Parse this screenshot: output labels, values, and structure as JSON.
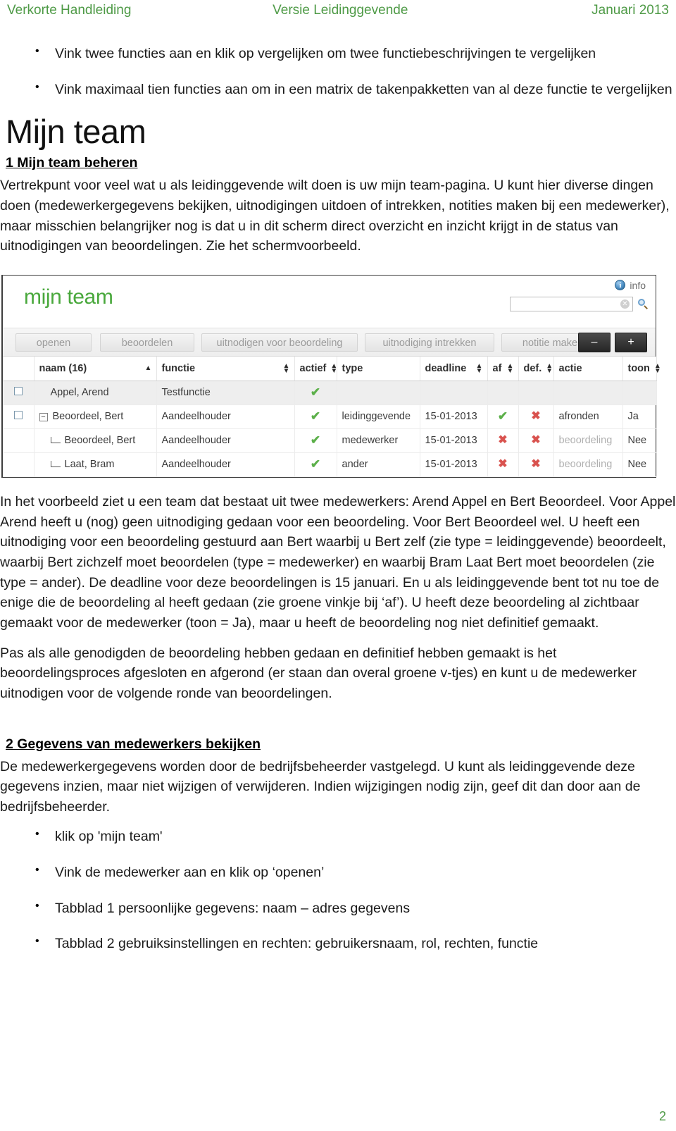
{
  "header": {
    "left": "Verkorte Handleiding",
    "center": "Versie Leidinggevende",
    "right": "Januari 2013"
  },
  "intro_bullets": [
    "Vink twee functies aan en klik op vergelijken om twee functiebeschrijvingen te vergelijken",
    "Vink maximaal tien functies aan om in een matrix de takenpakketten van al deze functie te vergelijken"
  ],
  "title": "Mijn team",
  "section1": {
    "heading": "1 Mijn team beheren",
    "paragraph": "Vertrekpunt voor veel wat u als leidinggevende wilt doen is uw mijn team-pagina. U kunt hier diverse dingen doen (medewerkergegevens bekijken, uitnodigingen uitdoen of intrekken, notities maken bij een medewerker), maar misschien belangrijker nog is dat u in dit scherm direct overzicht en inzicht krijgt in de status van uitnodigingen van beoordelingen. Zie het schermvoorbeeld."
  },
  "app_screenshot": {
    "logo": "mijn team",
    "info_icon": "info-icon",
    "info_label": "info",
    "search": {
      "value": "",
      "placeholder": "",
      "clear_icon": "clear-icon",
      "magnifier_icon": "search-icon"
    },
    "toolbar_buttons": [
      "openen",
      "beoordelen",
      "uitnodigen voor beoordeling",
      "uitnodiging intrekken",
      "notitie maken"
    ],
    "zoom_out_label": "–",
    "zoom_in_label": "+",
    "columns": [
      {
        "label": "naam (16)",
        "sort": "asc"
      },
      {
        "label": "functie",
        "sort": "both"
      },
      {
        "label": "actief",
        "sort": "both"
      },
      {
        "label": "type",
        "sort": "none"
      },
      {
        "label": "deadline",
        "sort": "both"
      },
      {
        "label": "af",
        "sort": "both"
      },
      {
        "label": "def.",
        "sort": "both"
      },
      {
        "label": "actie",
        "sort": "none"
      },
      {
        "label": "toon",
        "sort": "both"
      }
    ],
    "rows": [
      {
        "checkbox": true,
        "tree": "none",
        "indent": 0,
        "naam": "Appel, Arend",
        "functie": "Testfunctie",
        "actief": "check",
        "type": "",
        "deadline": "",
        "af": "",
        "def": "",
        "actie": "",
        "actie_muted": false,
        "toon": "",
        "shaded": true
      },
      {
        "checkbox": true,
        "tree": "collapse",
        "indent": 0,
        "naam": "Beoordeel, Bert",
        "functie": "Aandeelhouder",
        "actief": "check",
        "type": "leidinggevende",
        "deadline": "15-01-2013",
        "af": "check",
        "def": "cross",
        "actie": "afronden",
        "actie_muted": false,
        "toon": "Ja",
        "shaded": false
      },
      {
        "checkbox": false,
        "tree": "child",
        "indent": 1,
        "naam": "Beoordeel, Bert",
        "functie": "Aandeelhouder",
        "actief": "check",
        "type": "medewerker",
        "deadline": "15-01-2013",
        "af": "cross",
        "def": "cross",
        "actie": "beoordeling",
        "actie_muted": true,
        "toon": "Nee",
        "shaded": false
      },
      {
        "checkbox": false,
        "tree": "child",
        "indent": 1,
        "naam": "Laat, Bram",
        "functie": "Aandeelhouder",
        "actief": "check",
        "type": "ander",
        "deadline": "15-01-2013",
        "af": "cross",
        "def": "cross",
        "actie": "beoordeling",
        "actie_muted": true,
        "toon": "Nee",
        "shaded": false
      }
    ],
    "glyphs": {
      "check": "✔",
      "cross": "✖"
    }
  },
  "explain": {
    "p1": "In het voorbeeld ziet u een team dat bestaat uit twee medewerkers: Arend Appel en Bert Beoordeel. Voor Appel Arend heeft u (nog) geen uitnodiging gedaan voor een beoordeling. Voor Bert Beoordeel wel. U heeft een uitnodiging voor een beoordeling gestuurd aan Bert waarbij u Bert zelf (zie type = leidinggevende) beoordeelt, waarbij Bert zichzelf moet beoordelen (type = medewerker) en waarbij Bram Laat Bert moet beoordelen (zie type = ander). De deadline voor deze beoordelingen is 15 januari. En u als leidinggevende bent tot nu toe de enige die de beoordeling al heeft gedaan (zie groene vinkje bij ‘af’). U heeft deze beoordeling al zichtbaar gemaakt voor de medewerker (toon = Ja), maar u heeft de beoordeling nog niet definitief gemaakt.",
    "p2": "Pas als alle genodigden de beoordeling hebben gedaan en definitief hebben gemaakt is het beoordelingsproces afgesloten en afgerond (er staan dan overal groene v-tjes) en kunt u de medewerker uitnodigen voor de volgende ronde van beoordelingen."
  },
  "section2": {
    "heading": "2 Gegevens van medewerkers bekijken",
    "paragraph": "De medewerkergegevens worden door de bedrijfsbeheerder vastgelegd. U kunt als leidinggevende deze gegevens inzien, maar niet wijzigen of verwijderen. Indien wijzigingen nodig zijn, geef dit dan door aan de bedrijfsbeheerder.",
    "bullets": [
      "klik op 'mijn team'",
      "Vink de medewerker aan en klik op ‘openen’",
      "Tabblad 1 persoonlijke gegevens: naam – adres gegevens",
      "Tabblad 2 gebruiksinstellingen en rechten: gebruikersnaam, rol, rechten, functie"
    ]
  },
  "page_number": "2"
}
